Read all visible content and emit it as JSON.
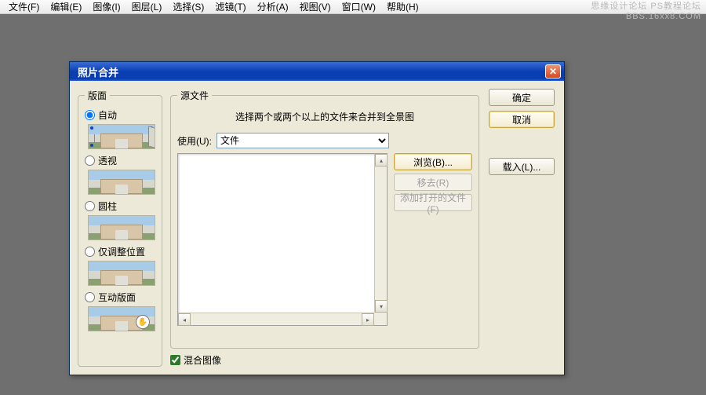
{
  "menu": {
    "file": "文件(F)",
    "edit": "编辑(E)",
    "image": "图像(I)",
    "layer": "图层(L)",
    "select": "选择(S)",
    "filter": "滤镜(T)",
    "analysis": "分析(A)",
    "view": "视图(V)",
    "window": "窗口(W)",
    "help": "帮助(H)"
  },
  "watermark": {
    "line1": "思缘设计论坛   PS教程论坛",
    "line2": "BBS.16xx8.COM"
  },
  "dialog": {
    "title": "照片合并",
    "close": "✕",
    "layout": {
      "legend": "版面",
      "auto": "自动",
      "perspective": "透视",
      "cylindrical": "圆柱",
      "reposition": "仅调整位置",
      "interactive": "互动版面"
    },
    "source": {
      "legend": "源文件",
      "instruction": "选择两个或两个以上的文件来合并到全景图",
      "use_label": "使用(U):",
      "use_value": "文件",
      "browse": "浏览(B)...",
      "remove": "移去(R)",
      "add_open": "添加打开的文件(F)",
      "blend": "混合图像"
    },
    "right": {
      "ok": "确定",
      "cancel": "取消",
      "load": "载入(L)..."
    }
  }
}
